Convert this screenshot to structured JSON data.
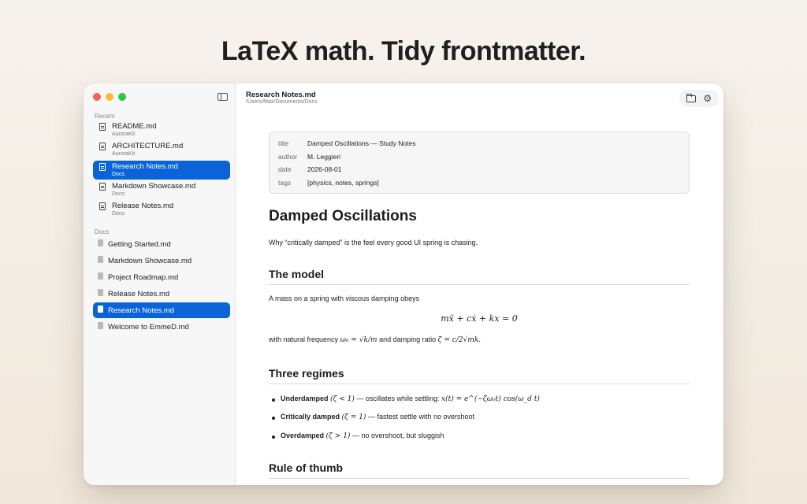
{
  "headline": "LaTeX math. Tidy frontmatter.",
  "window": {
    "title": "Research Notes.md",
    "path": "/Users/Max/Documents/Docs"
  },
  "sidebar": {
    "recent_label": "Recent",
    "recent": [
      {
        "name": "README.md",
        "project": "AuroraKit"
      },
      {
        "name": "ARCHITECTURE.md",
        "project": "AuroraKit"
      },
      {
        "name": "Research Notes.md",
        "project": "Docs",
        "selected": true
      },
      {
        "name": "Markdown Showcase.md",
        "project": "Docs"
      },
      {
        "name": "Release Notes.md",
        "project": "Docs"
      }
    ],
    "docs_label": "Docs",
    "docs": [
      {
        "name": "Getting Started.md"
      },
      {
        "name": "Markdown Showcase.md"
      },
      {
        "name": "Project Roadmap.md"
      },
      {
        "name": "Release Notes.md"
      },
      {
        "name": "Research Notes.md",
        "selected": true
      },
      {
        "name": "Welcome to EmmeD.md"
      }
    ]
  },
  "frontmatter": [
    {
      "key": "title",
      "value": "Damped Oscillations — Study Notes"
    },
    {
      "key": "author",
      "value": "M. Leggieri"
    },
    {
      "key": "date",
      "value": "2026-08-01"
    },
    {
      "key": "tags",
      "value": "[physics, notes, springs]"
    }
  ],
  "doc": {
    "h1": "Damped Oscillations",
    "intro": "Why “critically damped” is the feel every good UI spring is chasing.",
    "model_heading": "The model",
    "model_text": "A mass on a spring with viscous damping obeys",
    "equation": "mẍ + cẋ + kx = 0",
    "freq_prefix": "with natural frequency",
    "freq_math": "ω₀ = √k/m",
    "freq_mid": "and damping ratio",
    "zeta_math": "ζ = c/2√mk.",
    "regimes_heading": "Three regimes",
    "regimes": [
      {
        "name": "Underdamped",
        "cond": "(ζ < 1)",
        "desc": "— oscillates while settling:",
        "formula": "x(t) = e^(−ζω₀t) cos(ω_d t)"
      },
      {
        "name": "Critically damped",
        "cond": "(ζ = 1)",
        "desc": "— fastest settle with no overshoot",
        "formula": ""
      },
      {
        "name": "Overdamped",
        "cond": "(ζ > 1)",
        "desc": "— no overshoot, but sluggish",
        "formula": ""
      }
    ],
    "rule_heading": "Rule of thumb"
  },
  "colors": {
    "accent": "#0a64d8",
    "close": "#ff5f57",
    "minimize": "#febc2e",
    "zoom": "#28c840"
  },
  "icons": {
    "sidebar_toggle": "sidebar-toggle-icon",
    "folder": "folder-icon",
    "settings": "gear-icon"
  }
}
